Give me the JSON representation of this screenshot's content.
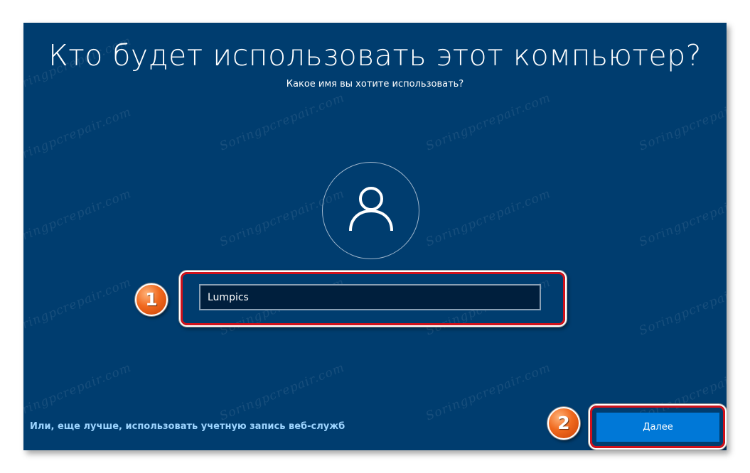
{
  "dialog": {
    "title": "Кто будет использовать этот компьютер?",
    "subtitle": "Какое имя вы хотите использовать?",
    "name_input_value": "Lumpics",
    "avatar_icon": "user-icon",
    "web_services_link": "Или, еще лучше, использовать учетную запись веб-служб",
    "next_button_label": "Далее"
  },
  "annotations": {
    "badge_1": "1",
    "badge_2": "2"
  },
  "watermark_text": "Soringpcrepair.com",
  "colors": {
    "background": "#003d6f",
    "input_background": "#001f3d",
    "button": "#0078d7",
    "link": "#9cd4ff",
    "highlight": "#d0121b",
    "badge": "#f0691e"
  }
}
